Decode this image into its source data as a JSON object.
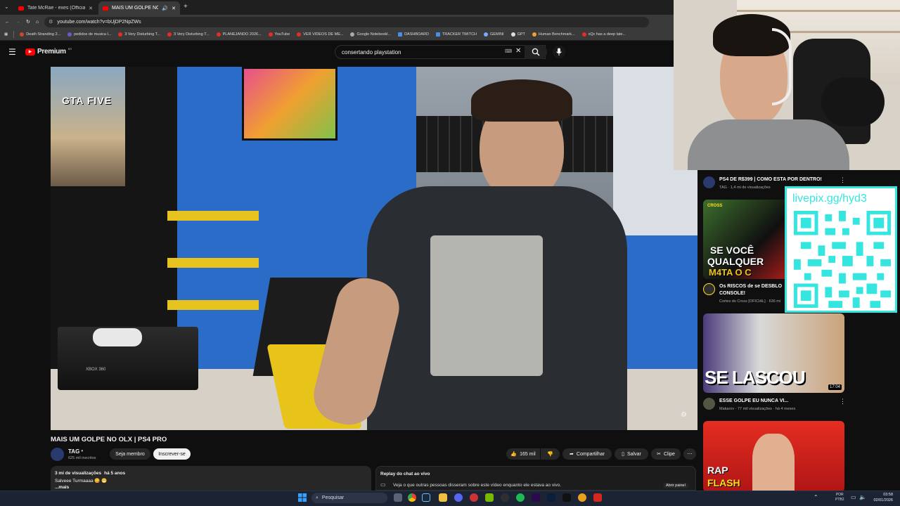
{
  "browser": {
    "tabs": [
      {
        "label": "Tate McRae - exes (Official Vide",
        "active": false
      },
      {
        "label": "MAIS UM GOLPE NO OLX | PS4",
        "active": true
      }
    ],
    "url": "youtube.com/watch?v=bUjDP2NpZWs",
    "bookmarks": [
      "Death Stranding 2...",
      "pedidos de musica l...",
      "3 Very Disturbing T...",
      "3 Very Disturbing T...",
      "PLANEJANDO 2026...",
      "YouTube",
      "VER VIDEOS DE ME...",
      "Google Notebookl...",
      "DASHBOARD",
      "TRACKER TWITCH",
      "GEMINI",
      "GPT",
      "Human Benchmark...",
      "xQc has a deep late..."
    ]
  },
  "youtube": {
    "logo": "Premium",
    "logo_badge": "BR",
    "search_value": "consertando playstation"
  },
  "video": {
    "title": "MAIS UM GOLPE NO OLX | PS4 PRO",
    "poster_text": "GTA FIVE",
    "console_label": "XBOX 360"
  },
  "channel": {
    "name": "TAG",
    "subscribers": "625 mil inscritos",
    "join_label": "Seja membro",
    "subscribe_label": "Inscrever-se"
  },
  "actions": {
    "likes": "165 mil",
    "share": "Compartilhar",
    "save": "Salvar",
    "clip": "Clipe"
  },
  "description": {
    "views": "3 mi de visualizações",
    "age": "há 5 anos",
    "line": "Salveee Turmaaaa 😋 😁",
    "more": "...mais"
  },
  "chat_replay": {
    "title": "Replay do chat ao vivo",
    "text": "Veja o que outras pessoas disseram sobre este vídeo enquanto ele estava ao vivo.",
    "open_label": "Abrir painel"
  },
  "overlay": {
    "livepix": "livepix.gg/hyd3"
  },
  "related": [
    {
      "title": "PS4 DE R$399 | COMO ESTA POR DENTRO!",
      "meta": "TAG · 1,4 mi de visualizações"
    },
    {
      "title": "Os RISCOS de se DESBLO",
      "title2": "CONSOLE!",
      "meta": "Cortes do Cross [OFICIAL] · 636 mi",
      "thumb_text1": "SE VOCÊ",
      "thumb_text2": "QUALQUER",
      "thumb_text3": "M4TA O C",
      "badge": "CROSS"
    },
    {
      "title": "ESSE GOLPE EU NUNCA VI...",
      "meta": "Makarov · 77 mil visualizações · há 4 meses",
      "thumb_text": "SE LASCOU",
      "duration": "17:04"
    },
    {
      "thumb_text1": "RAP",
      "thumb_text2": "FLASH"
    }
  ],
  "taskbar": {
    "search": "Pesquisar",
    "lang1": "POR",
    "lang2": "PTB2",
    "time": "03:58",
    "date": "02/01/2026"
  },
  "colors": {
    "yt_red": "#ff0000",
    "accent_cyan": "#35e6e0",
    "video_blue": "#2a6cc7"
  }
}
